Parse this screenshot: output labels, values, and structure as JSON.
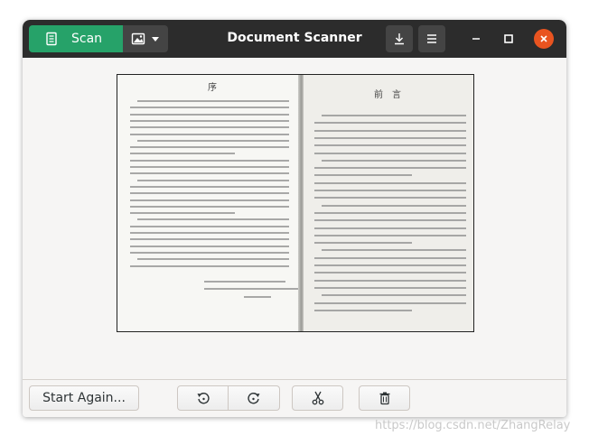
{
  "header": {
    "title": "Document Scanner",
    "scan_label": "Scan",
    "colors": {
      "scan": "#26a269",
      "headerbar": "#2c2c2c",
      "close": "#e95420"
    }
  },
  "preview": {
    "left_heading": "序",
    "right_heading": "前　言"
  },
  "footer": {
    "start_again_label": "Start Again..."
  },
  "watermark": "https://blog.csdn.net/ZhangRelay",
  "icons": [
    "document-icon",
    "image-icon",
    "chevron-down-icon",
    "save-icon",
    "menu-icon",
    "minimize-icon",
    "maximize-icon",
    "close-icon",
    "rotate-left-icon",
    "rotate-right-icon",
    "crop-icon",
    "delete-icon"
  ]
}
